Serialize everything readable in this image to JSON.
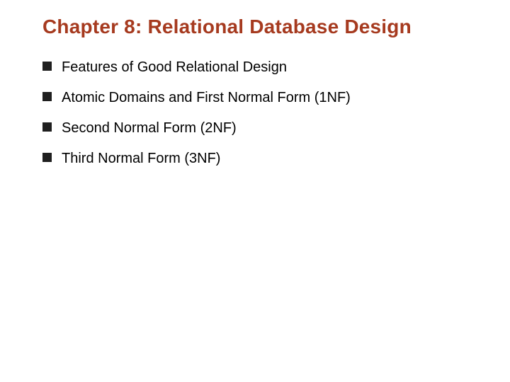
{
  "title": "Chapter 8:  Relational Database Design",
  "bullets": [
    {
      "text": "Features of Good Relational Design"
    },
    {
      "text": "Atomic Domains and First Normal Form (1NF)"
    },
    {
      "text": "Second Normal Form (2NF)"
    },
    {
      "text": "Third Normal Form (3NF)"
    }
  ]
}
